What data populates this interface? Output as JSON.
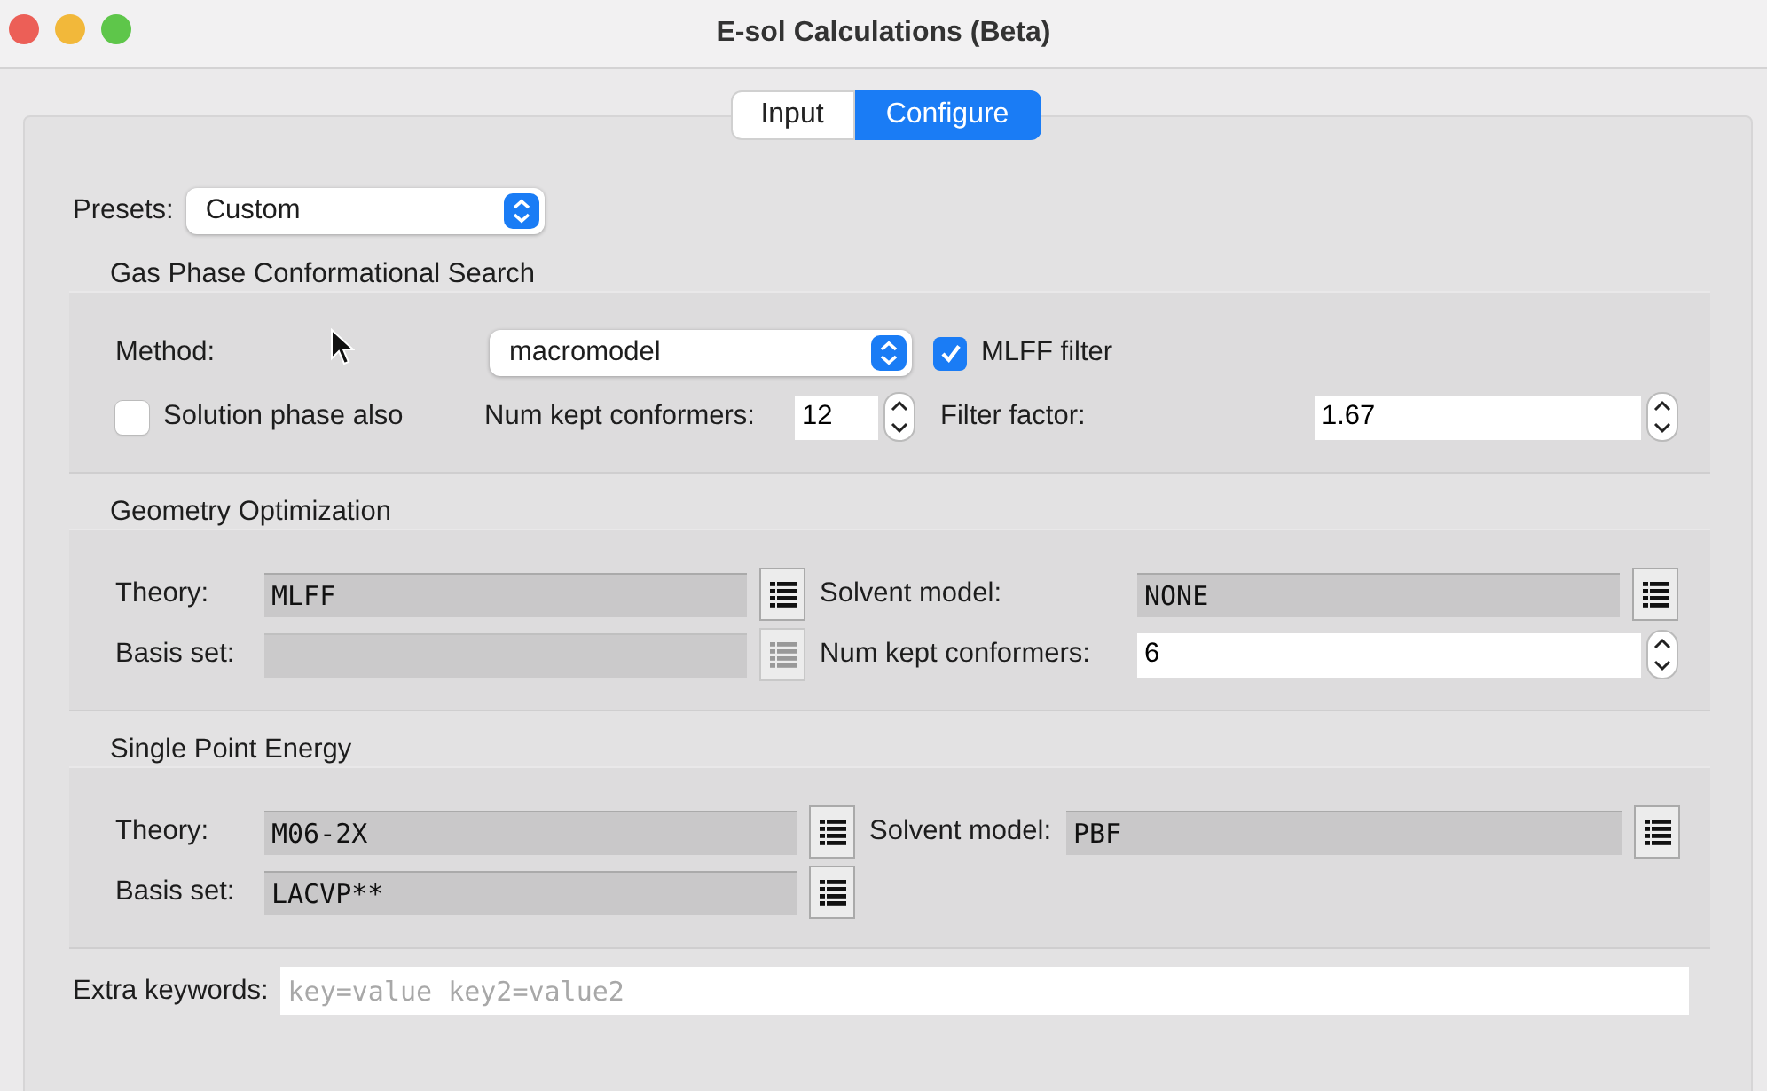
{
  "window": {
    "title": "E-sol Calculations (Beta)"
  },
  "tabs": [
    {
      "label": "Input",
      "selected": false
    },
    {
      "label": "Configure",
      "selected": true
    }
  ],
  "presets": {
    "label": "Presets:",
    "value": "Custom"
  },
  "groups": [
    {
      "title": "Gas Phase Conformational Search",
      "rows": [
        [
          {
            "kind": "label",
            "text": "Method:"
          },
          {
            "kind": "select",
            "value": "macromodel"
          },
          "",
          {
            "kind": "checkbox",
            "label": "MLFF filter",
            "checked": true
          }
        ],
        [
          {
            "kind": "checkbox",
            "label": "Solution phase also",
            "checked": false
          },
          {
            "kind": "label",
            "text": "Num kept conformers:"
          },
          {
            "kind": "spin",
            "value": "12"
          },
          {
            "kind": "label",
            "text": "Filter factor:"
          },
          {
            "kind": "spin",
            "value": "1.67"
          }
        ]
      ]
    },
    {
      "title": "Geometry Optimization",
      "rows": [
        [
          {
            "kind": "label",
            "text": "Theory:"
          },
          {
            "kind": "list_field",
            "value": "MLFF",
            "disabled": false
          },
          {
            "kind": "label",
            "text": "Solvent model:"
          },
          {
            "kind": "list_field",
            "value": "NONE",
            "disabled": false
          }
        ],
        [
          {
            "kind": "label",
            "text": "Basis set:"
          },
          {
            "kind": "list_field",
            "disabled": true
          },
          {
            "kind": "label",
            "text": "Num kept conformers:"
          },
          {
            "kind": "spin",
            "value": "6"
          }
        ]
      ]
    },
    {
      "title": "Single Point Energy",
      "rows": [
        [
          {
            "kind": "label",
            "text": "Theory:"
          },
          {
            "kind": "list_field",
            "value": "M06-2X",
            "disabled": false
          },
          {
            "kind": "label",
            "text": "Solvent model:"
          },
          {
            "kind": "list_field",
            "value": "PBF",
            "disabled": false
          }
        ],
        [
          {
            "kind": "label",
            "text": "Basis set:"
          },
          {
            "kind": "list_field",
            "value": "LACVP**",
            "disabled": false
          }
        ]
      ]
    }
  ],
  "extra": {
    "label": "Extra keywords:",
    "placeholder": "key=value key2=value2"
  }
}
